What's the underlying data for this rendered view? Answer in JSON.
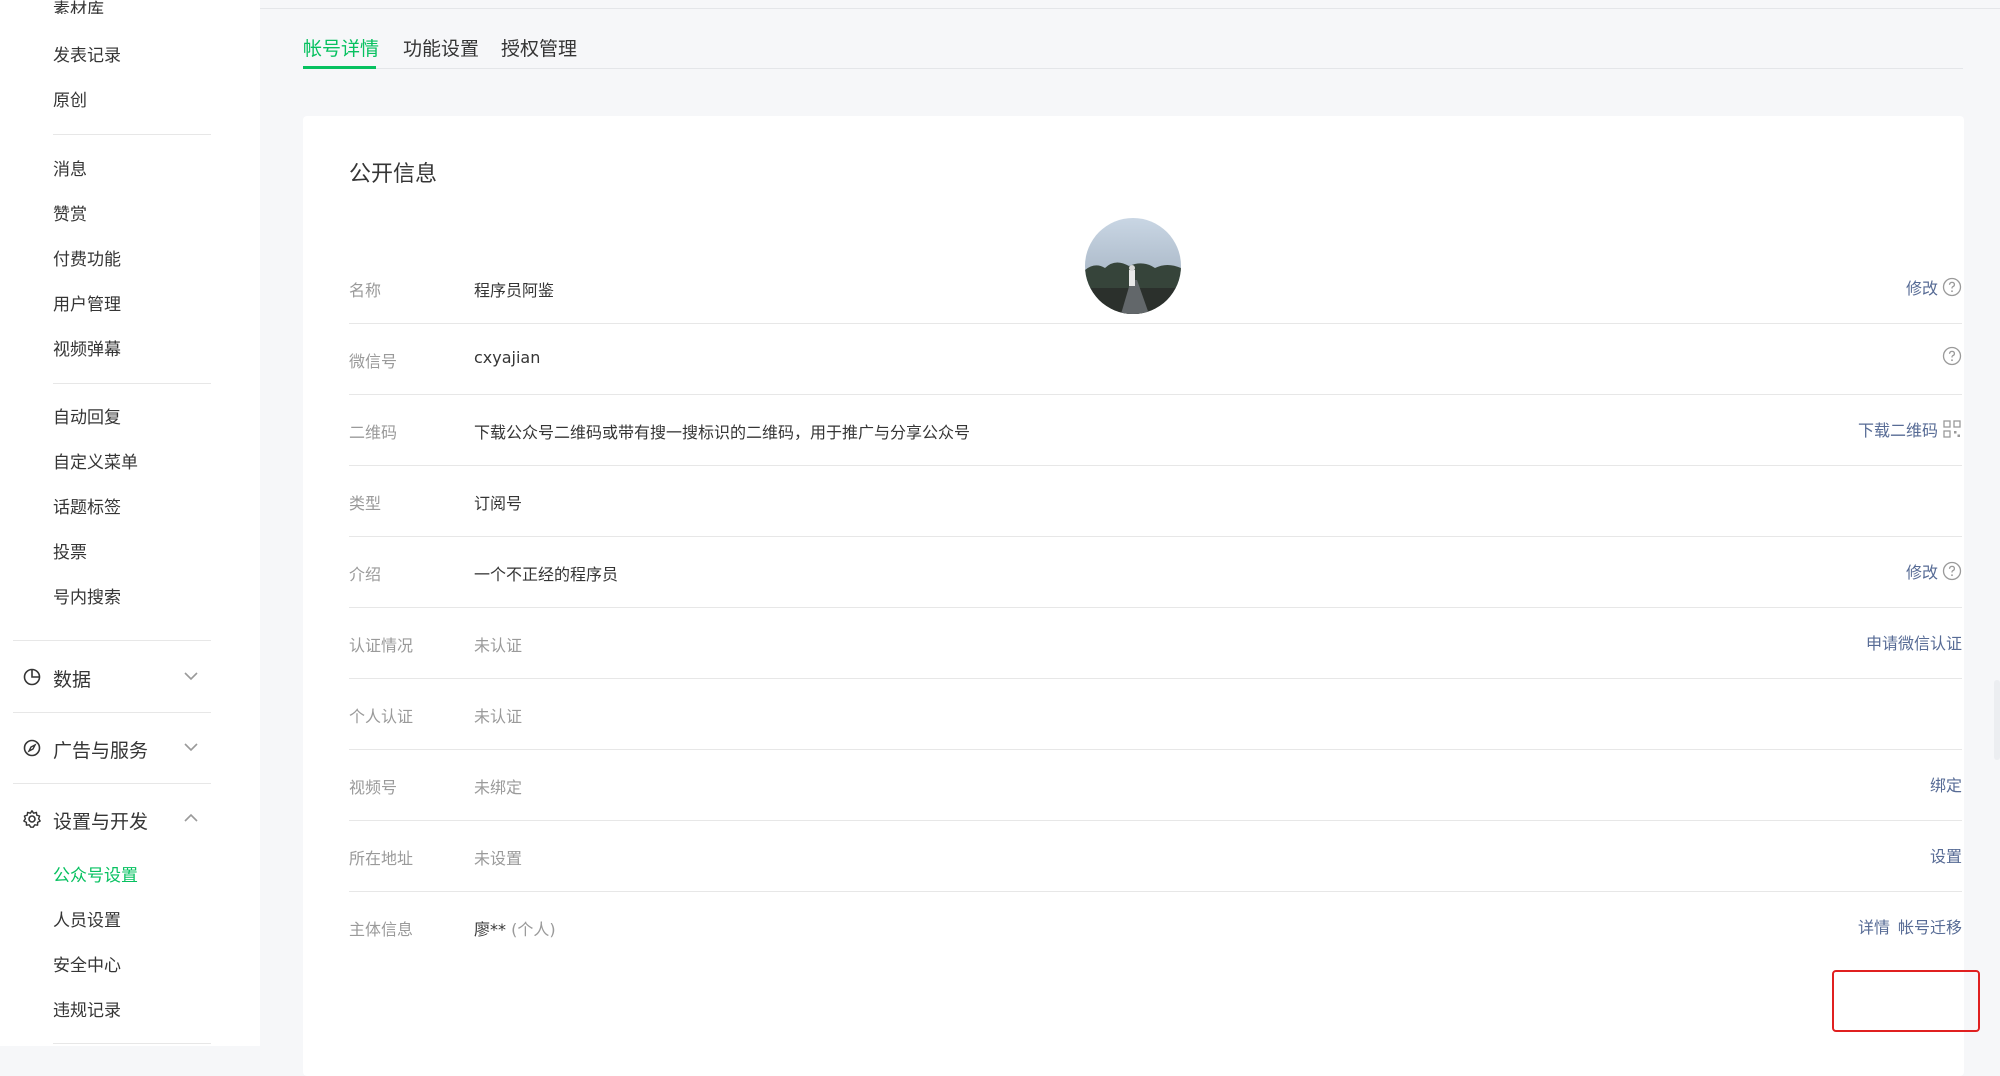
{
  "sidebar": {
    "top_cut": "素材库",
    "content_items": [
      "发表记录",
      "原创"
    ],
    "interact_items": [
      "消息",
      "赞赏",
      "付费功能",
      "用户管理",
      "视频弹幕"
    ],
    "tools_items": [
      "自动回复",
      "自定义菜单",
      "话题标签",
      "投票",
      "号内搜索"
    ],
    "groups": {
      "data": "数据",
      "ads": "广告与服务",
      "settings": "设置与开发"
    },
    "settings_items": [
      "公众号设置",
      "人员设置",
      "安全中心",
      "违规记录"
    ],
    "active_item": "公众号设置"
  },
  "tabs": [
    "帐号详情",
    "功能设置",
    "授权管理"
  ],
  "card": {
    "title": "公开信息",
    "rows": [
      {
        "label": "名称",
        "value": "程序员阿鉴",
        "action": "修改",
        "help": true
      },
      {
        "label": "微信号",
        "value": "cxyajian",
        "action": "",
        "help": true
      },
      {
        "label": "二维码",
        "value": "下载公众号二维码或带有搜一搜标识的二维码，用于推广与分享公众号",
        "action": "下载二维码"
      },
      {
        "label": "类型",
        "value": "订阅号",
        "action": ""
      },
      {
        "label": "介绍",
        "value": "一个不正经的程序员",
        "action": "修改",
        "help": true
      },
      {
        "label": "认证情况",
        "value": "未认证",
        "action": "申请微信认证"
      },
      {
        "label": "个人认证",
        "value": "未认证",
        "action": ""
      },
      {
        "label": "视频号",
        "value": "未绑定",
        "action": "绑定"
      },
      {
        "label": "所在地址",
        "value": "未设置",
        "action": "设置"
      },
      {
        "label": "主体信息",
        "value": "廖**",
        "value_sub": "(个人)",
        "action": "详情",
        "action2": "帐号迁移"
      }
    ]
  },
  "colors": {
    "accent": "#07c160",
    "link": "#576b95",
    "highlight": "#e02020"
  }
}
